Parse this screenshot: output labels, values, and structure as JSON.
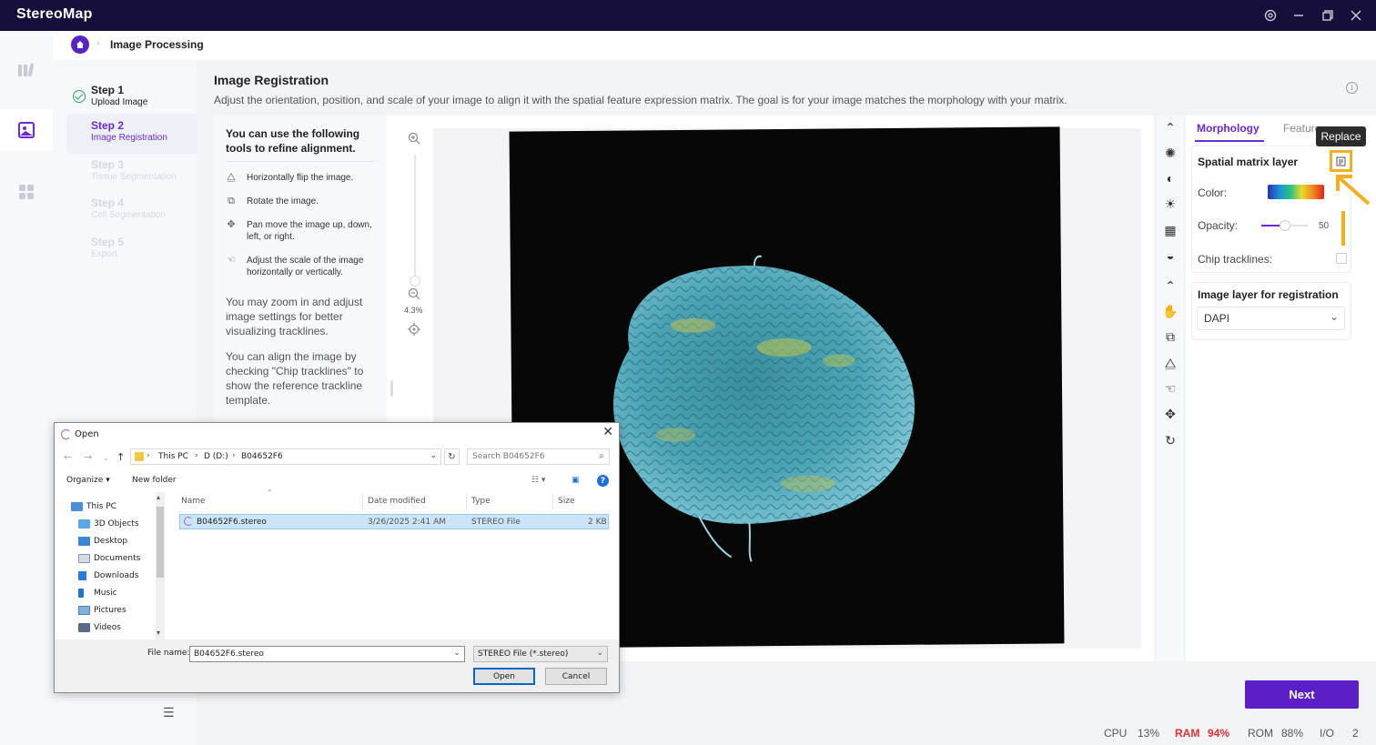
{
  "app": {
    "title": "StereoMap"
  },
  "breadcrumb": {
    "title": "Image Processing"
  },
  "steps": [
    {
      "title": "Step 1",
      "subtitle": "Upload Image",
      "state": "done"
    },
    {
      "title": "Step 2",
      "subtitle": "Image Registration",
      "state": "current"
    },
    {
      "title": "Step 3",
      "subtitle": "Tissue Segmentation",
      "state": "pending"
    },
    {
      "title": "Step 4",
      "subtitle": "Cell Segmentation",
      "state": "pending"
    },
    {
      "title": "Step 5",
      "subtitle": "Export",
      "state": "pending"
    }
  ],
  "main": {
    "title": "Image Registration",
    "description": "Adjust the orientation, position, and scale of your image to align it with the spatial feature expression matrix. The goal is for your image matches the morphology with your matrix."
  },
  "tips": {
    "heading": "You can use the following tools to refine alignment.",
    "items": [
      {
        "icon": "flip-icon",
        "text": "Horizontally flip the image."
      },
      {
        "icon": "rotate-icon",
        "text": "Rotate the image."
      },
      {
        "icon": "move-icon",
        "text": "Pan move the image up, down, left, or right."
      },
      {
        "icon": "scale-icon",
        "text": "Adjust the scale of the image horizontally or vertically."
      }
    ],
    "para1": "You may zoom in and adjust image settings for better visualizing tracklines.",
    "para2": "You can align the image by checking \"Chip tracklines\" to show the reference trackline template."
  },
  "zoom": {
    "level": "4.3%"
  },
  "right_panel": {
    "tabs": [
      "Morphology",
      "Feature"
    ],
    "tooltip": "Replace",
    "spatial_layer": {
      "title": "Spatial matrix layer",
      "color_label": "Color:",
      "opacity_label": "Opacity:",
      "opacity_value": "50",
      "tracklines_label": "Chip tracklines:"
    },
    "image_layer": {
      "title": "Image layer for registration",
      "selected": "DAPI"
    }
  },
  "next_button": "Next",
  "status": {
    "cpu_label": "CPU",
    "cpu_value": "13%",
    "ram_label": "RAM",
    "ram_value": "94%",
    "rom_label": "ROM",
    "rom_value": "88%",
    "io_label": "I/O",
    "io_value": "2"
  },
  "dialog": {
    "title": "Open",
    "path": [
      "This PC",
      "D (D:)",
      "B04652F6"
    ],
    "search_placeholder": "Search B04652F6",
    "organize": "Organize",
    "new_folder": "New folder",
    "tree": [
      "This PC",
      "3D Objects",
      "Desktop",
      "Documents",
      "Downloads",
      "Music",
      "Pictures",
      "Videos"
    ],
    "columns": [
      "Name",
      "Date modified",
      "Type",
      "Size"
    ],
    "files": [
      {
        "name": "B04652F6.stereo",
        "date": "3/26/2025 2:41 AM",
        "type": "STEREO File",
        "size": "2 KB"
      }
    ],
    "filename_label": "File name:",
    "filename_value": "B04652F6.stereo",
    "filetype": "STEREO File (*.stereo)",
    "open_button": "Open",
    "cancel_button": "Cancel"
  }
}
